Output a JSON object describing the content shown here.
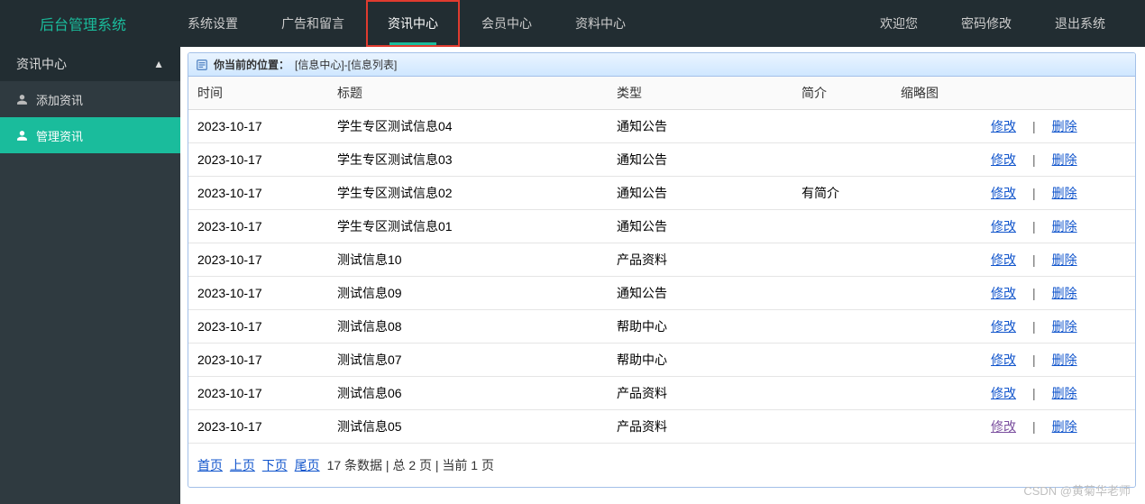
{
  "logo": "后台管理系统",
  "topnav": [
    {
      "label": "系统设置"
    },
    {
      "label": "广告和留言"
    },
    {
      "label": "资讯中心"
    },
    {
      "label": "会员中心"
    },
    {
      "label": "资料中心"
    }
  ],
  "topnavRight": [
    {
      "label": "欢迎您"
    },
    {
      "label": "密码修改"
    },
    {
      "label": "退出系统"
    }
  ],
  "sidebar": {
    "header": "资讯中心",
    "items": [
      {
        "label": "添加资讯"
      },
      {
        "label": "管理资讯"
      }
    ]
  },
  "breadcrumb": {
    "prefix": "你当前的位置：",
    "path": "[信息中心]-[信息列表]"
  },
  "columns": {
    "time": "时间",
    "title": "标题",
    "type": "类型",
    "intro": "简介",
    "thumb": "缩略图",
    "actions": ""
  },
  "actionLabels": {
    "edit": "修改",
    "delete": "删除"
  },
  "rows": [
    {
      "time": "2023-10-17",
      "title": "学生专区测试信息04",
      "type": "通知公告",
      "intro": "",
      "thumb": ""
    },
    {
      "time": "2023-10-17",
      "title": "学生专区测试信息03",
      "type": "通知公告",
      "intro": "",
      "thumb": ""
    },
    {
      "time": "2023-10-17",
      "title": "学生专区测试信息02",
      "type": "通知公告",
      "intro": "有简介",
      "thumb": ""
    },
    {
      "time": "2023-10-17",
      "title": "学生专区测试信息01",
      "type": "通知公告",
      "intro": "",
      "thumb": ""
    },
    {
      "time": "2023-10-17",
      "title": "测试信息10",
      "type": "产品资料",
      "intro": "",
      "thumb": ""
    },
    {
      "time": "2023-10-17",
      "title": "测试信息09",
      "type": "通知公告",
      "intro": "",
      "thumb": ""
    },
    {
      "time": "2023-10-17",
      "title": "测试信息08",
      "type": "帮助中心",
      "intro": "",
      "thumb": ""
    },
    {
      "time": "2023-10-17",
      "title": "测试信息07",
      "type": "帮助中心",
      "intro": "",
      "thumb": ""
    },
    {
      "time": "2023-10-17",
      "title": "测试信息06",
      "type": "产品资料",
      "intro": "",
      "thumb": ""
    },
    {
      "time": "2023-10-17",
      "title": "测试信息05",
      "type": "产品资料",
      "intro": "",
      "thumb": "",
      "editVisited": true
    }
  ],
  "pager": {
    "first": "首页",
    "prev": "上页",
    "next": "下页",
    "last": "尾页",
    "info": "17 条数据 | 总 2 页 | 当前 1 页"
  },
  "watermark": "CSDN @黄菊华老师"
}
